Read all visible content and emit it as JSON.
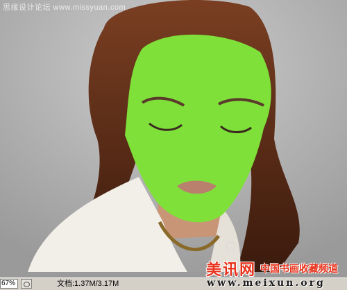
{
  "canvas": {
    "top_watermark": "思缘设计论坛  www.missyuan.com",
    "quick_mask_color": "#7fe03a"
  },
  "statusbar": {
    "zoom": "67%",
    "doc_info": "文档:1.37M/3.17M"
  },
  "watermark": {
    "logo": "美讯网",
    "slogan": "中国书画收藏频道",
    "url": "www.meixun.org",
    "color": "#e8331c"
  },
  "icons": {
    "brush_cursor": "brush-cursor-icon",
    "status_menu": "status-arrow-icon"
  }
}
